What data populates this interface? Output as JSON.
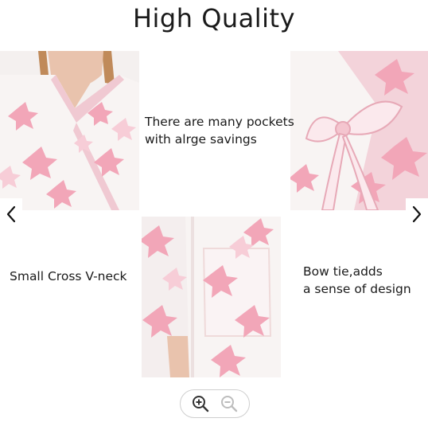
{
  "title": "High Quality",
  "captions": {
    "pockets_line1": "There are many pockets",
    "pockets_line2": "with alrge savings",
    "neck": "Small Cross V-neck",
    "bow_line1": "Bow tie,adds",
    "bow_line2": "a sense of design"
  },
  "photos": [
    {
      "name": "neck-closeup-photo",
      "subject": "model wearing pink floral kimono robe, V-neck detail"
    },
    {
      "name": "bow-closeup-photo",
      "subject": "fabric bow tie at waist"
    },
    {
      "name": "pocket-closeup-photo",
      "subject": "side pocket of floral robe"
    }
  ],
  "navigation": {
    "prev_icon": "chevron-left-icon",
    "next_icon": "chevron-right-icon"
  },
  "zoom": {
    "zoom_in_icon": "zoom-in-icon",
    "zoom_out_icon": "zoom-out-icon",
    "zoom_out_enabled": false
  },
  "colors": {
    "petal": "#f2a6b8",
    "petal_light": "#f7cdd7",
    "fabric": "#f8f4f3",
    "skin": "#e9c3ad",
    "hair": "#c08a5a"
  }
}
